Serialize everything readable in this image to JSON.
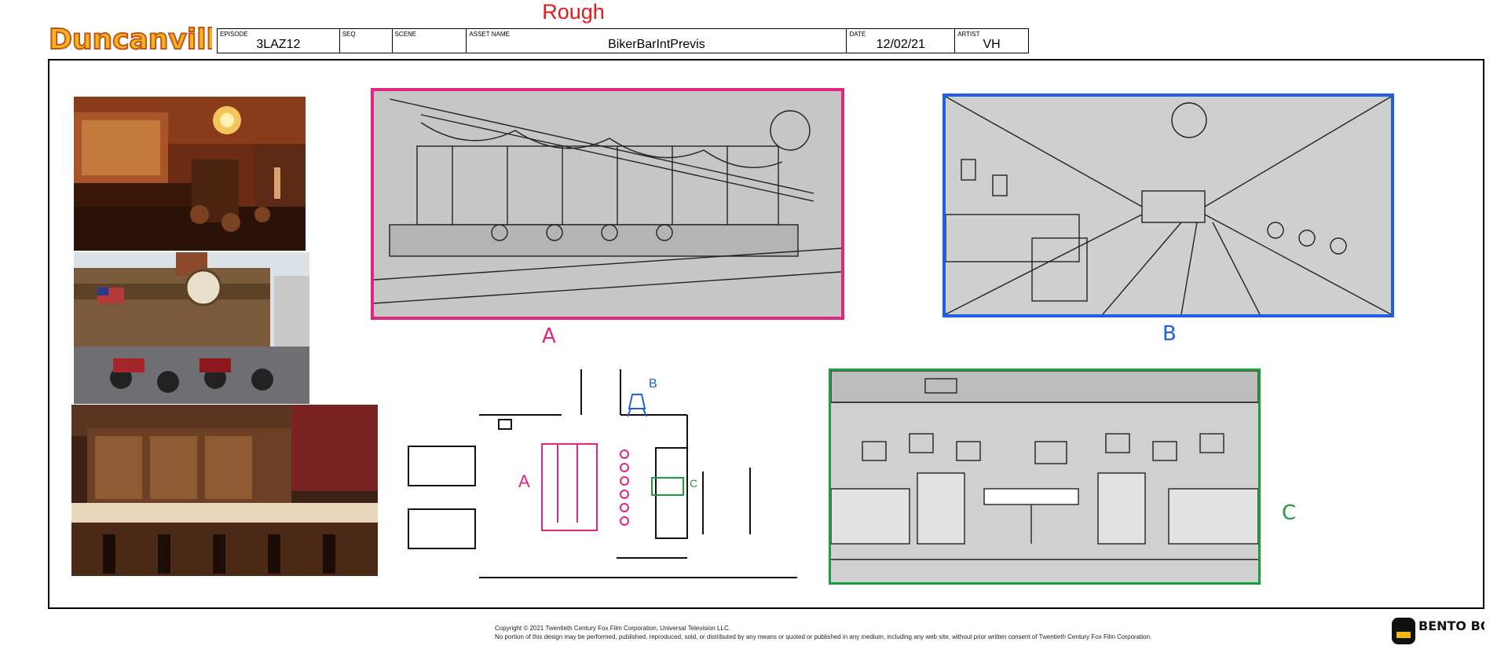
{
  "header": {
    "status": "Rough",
    "fields": [
      {
        "label": "EPISODE",
        "value": "3LAZ12"
      },
      {
        "label": "SEQ",
        "value": ""
      },
      {
        "label": "SCENE",
        "value": ""
      },
      {
        "label": "ASSET NAME",
        "value": "BikerBarIntPrevis"
      },
      {
        "label": "DATE",
        "value": "12/02/21"
      },
      {
        "label": "ARTIST",
        "value": "VH"
      }
    ]
  },
  "logos": {
    "show_logo_text": "Duncanville",
    "studio_logo_text": "BENTO BOX"
  },
  "panels": {
    "a_label": "A",
    "b_label": "B",
    "c_label": "C"
  },
  "floorplan": {
    "label_a": "A",
    "label_b": "B",
    "label_c": "C"
  },
  "footer": {
    "copyright": "Copyright © 2021 Twentieth Century Fox Film Corporation, Universal Television LLC.",
    "notice": "No portion of this design may be performed, published, reproduced, sold, or distributed by any means or quoted or published in any medium, including any web site, without prior written consent of Twentieth Century Fox Film Corporation."
  },
  "colors": {
    "panel_a": "#e0267f",
    "panel_b": "#1f5fe0",
    "panel_c": "#1e9e3a",
    "rough": "#e21b1b"
  }
}
